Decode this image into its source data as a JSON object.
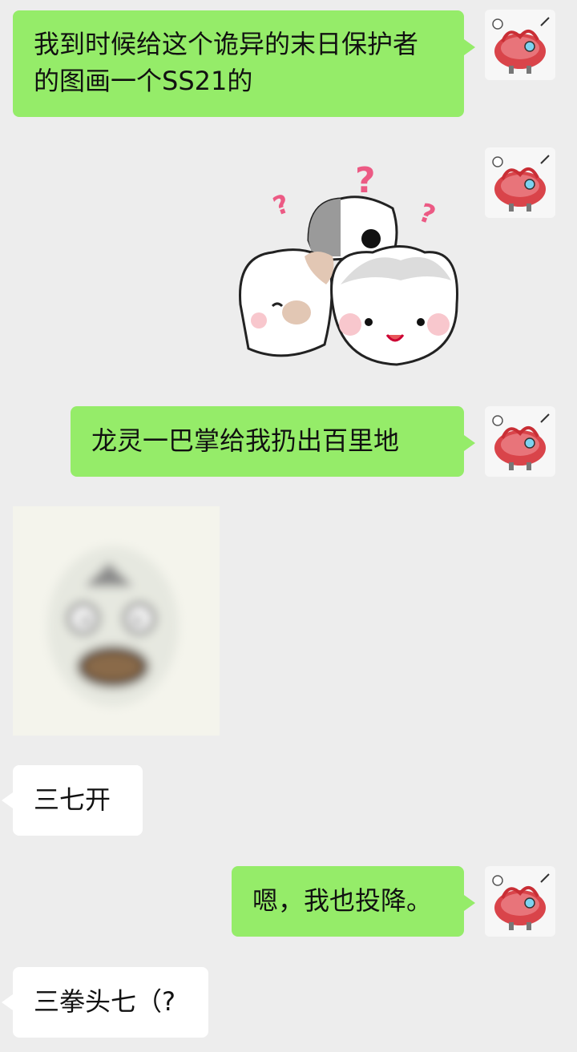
{
  "messages": [
    {
      "side": "right",
      "type": "text",
      "text": "我到时候给这个诡异的末日保护者的图画一个SS21的"
    },
    {
      "side": "right",
      "type": "sticker",
      "sticker": "confused-bunnies-sticker"
    },
    {
      "side": "right",
      "type": "text",
      "text": "龙灵一巴掌给我扔出百里地"
    },
    {
      "side": "left",
      "type": "sticker",
      "sticker": "shocked-face-sticker"
    },
    {
      "side": "left",
      "type": "text",
      "text": "三七开"
    },
    {
      "side": "right",
      "type": "text",
      "text": "嗯，我也投降。"
    },
    {
      "side": "left",
      "type": "text",
      "text": "三拳头七（?"
    }
  ],
  "colors": {
    "background": "#ededed",
    "outgoing_bubble": "#95ec69",
    "incoming_bubble": "#ffffff",
    "text": "#111111"
  },
  "avatar_icon": "red-cartoon-avatar-icon"
}
